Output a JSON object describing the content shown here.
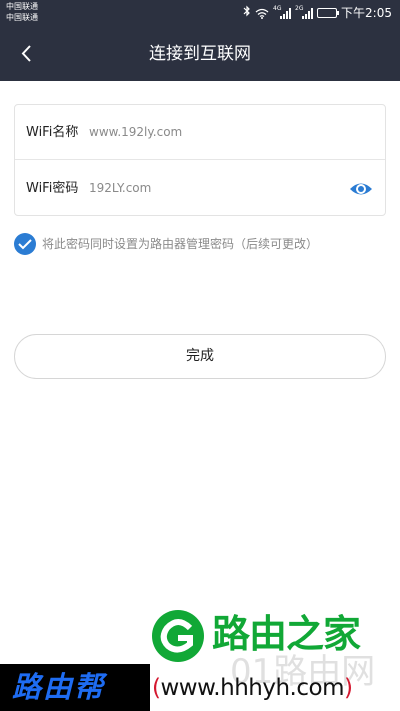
{
  "status_bar": {
    "carrier_1": "中国联通",
    "carrier_2": "中国联通",
    "signal_1_tag": "4G",
    "signal_2_tag": "2G",
    "time": "下午2:05",
    "battery_level": 0.9,
    "icons": [
      "bluetooth-icon",
      "wifi-icon",
      "signal-icon",
      "battery-icon"
    ]
  },
  "nav": {
    "title": "连接到互联网",
    "back_icon": "chevron-left-icon"
  },
  "form": {
    "wifi_name_label": "WiFi名称",
    "wifi_name_value": "www.192ly.com",
    "wifi_password_label": "WiFi密码",
    "wifi_password_value": "192LY.com",
    "password_visibility_icon": "eye-icon"
  },
  "checkbox": {
    "checked": true,
    "label": "将此密码同时设置为路由器管理密码（后续可更改）"
  },
  "done_button": {
    "label": "完成"
  },
  "watermarks": {
    "left_text": "路由帮",
    "brand_text": "路由之家",
    "faint_text": "01路由网",
    "url_open": "(",
    "url": "www.hhhyh.com",
    "url_close": ")"
  },
  "colors": {
    "header_bg": "#2c3140",
    "accent_blue": "#2b7cd3",
    "brand_green": "#11a836",
    "url_paren_red": "#d4172f"
  }
}
